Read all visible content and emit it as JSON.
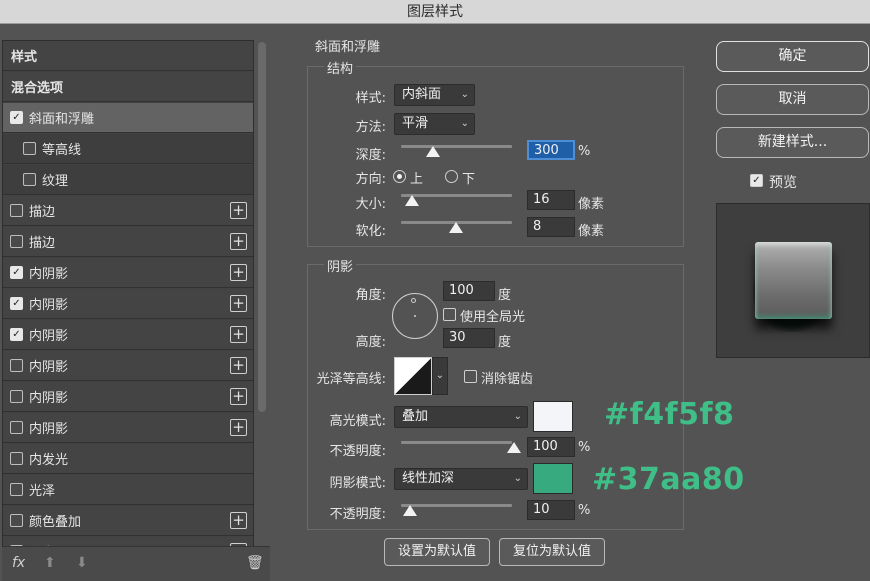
{
  "window": {
    "title": "图层样式"
  },
  "left_panel": {
    "items": [
      {
        "label": "样式",
        "type": "plain"
      },
      {
        "label": "混合选项",
        "type": "plain"
      },
      {
        "label": "斜面和浮雕",
        "type": "check",
        "checked": true,
        "selected": true
      },
      {
        "label": "等高线",
        "type": "sub",
        "checked": false
      },
      {
        "label": "纹理",
        "type": "sub",
        "checked": false
      },
      {
        "label": "描边",
        "type": "check",
        "checked": false,
        "plus": true
      },
      {
        "label": "描边",
        "type": "check",
        "checked": false,
        "plus": true
      },
      {
        "label": "内阴影",
        "type": "check",
        "checked": true,
        "plus": true
      },
      {
        "label": "内阴影",
        "type": "check",
        "checked": true,
        "plus": true
      },
      {
        "label": "内阴影",
        "type": "check",
        "checked": true,
        "plus": true
      },
      {
        "label": "内阴影",
        "type": "check",
        "checked": false,
        "plus": true
      },
      {
        "label": "内阴影",
        "type": "check",
        "checked": false,
        "plus": true
      },
      {
        "label": "内阴影",
        "type": "check",
        "checked": false,
        "plus": true
      },
      {
        "label": "内发光",
        "type": "check",
        "checked": false
      },
      {
        "label": "光泽",
        "type": "check",
        "checked": false
      },
      {
        "label": "颜色叠加",
        "type": "check",
        "checked": false,
        "plus": true
      },
      {
        "label": "渐变叠加",
        "type": "check",
        "checked": false,
        "plus": true
      }
    ],
    "footer": {
      "fx": "fx",
      "up": "⬆",
      "down": "⬇",
      "trash": "🗑"
    }
  },
  "bevel": {
    "section_title": "斜面和浮雕",
    "structure": {
      "title": "结构",
      "style_label": "样式:",
      "style_value": "内斜面",
      "method_label": "方法:",
      "method_value": "平滑",
      "depth_label": "深度:",
      "depth_value": "300",
      "depth_unit": "%",
      "direction_label": "方向:",
      "direction_up": "上",
      "direction_down": "下",
      "size_label": "大小:",
      "size_value": "16",
      "size_unit": "像素",
      "soften_label": "软化:",
      "soften_value": "8",
      "soften_unit": "像素"
    },
    "shading": {
      "title": "阴影",
      "angle_label": "角度:",
      "angle_value": "100",
      "angle_unit": "度",
      "global_light_label": "使用全局光",
      "altitude_label": "高度:",
      "altitude_value": "30",
      "altitude_unit": "度",
      "gloss_contour_label": "光泽等高线:",
      "anti_alias_label": "消除锯齿",
      "highlight_mode_label": "高光模式:",
      "highlight_mode_value": "叠加",
      "highlight_opacity_label": "不透明度:",
      "highlight_opacity_value": "100",
      "highlight_opacity_unit": "%",
      "shadow_mode_label": "阴影模式:",
      "shadow_mode_value": "线性加深",
      "shadow_opacity_label": "不透明度:",
      "shadow_opacity_value": "10",
      "shadow_opacity_unit": "%",
      "highlight_color": "#f4f5f8",
      "shadow_color": "#37aa80"
    },
    "make_default": "设置为默认值",
    "reset_default": "复位为默认值"
  },
  "annotations": {
    "highlight_hex": "#f4f5f8",
    "shadow_hex": "#37aa80"
  },
  "right_panel": {
    "ok": "确定",
    "cancel": "取消",
    "new_style": "新建样式...",
    "preview_label": "预览"
  }
}
